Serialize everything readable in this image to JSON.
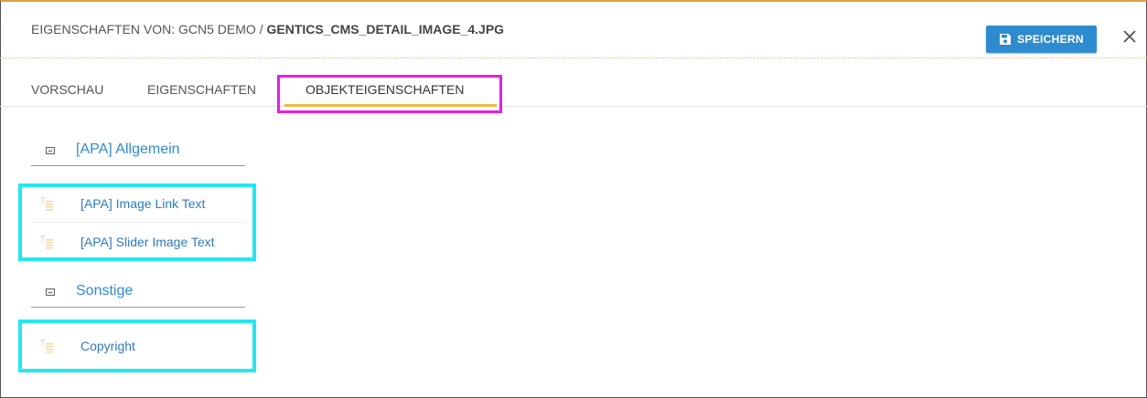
{
  "header": {
    "title_prefix": "EIGENSCHAFTEN VON: GCN5 DEMO / ",
    "title_file": "GENTICS_CMS_DETAIL_IMAGE_4.JPG",
    "save_label": "SPEICHERN",
    "save_icon": "floppy-disk-icon",
    "close_icon": "close-icon"
  },
  "tabs": [
    {
      "label": "VORSCHAU"
    },
    {
      "label": "EIGENSCHAFTEN"
    },
    {
      "label": "OBJEKTEIGENSCHAFTEN"
    }
  ],
  "active_tab": "OBJEKTEIGENSCHAFTEN",
  "groups": [
    {
      "label": "[APA] Allgemein",
      "items": [
        {
          "label": "[APA] Image Link Text",
          "icon": "text-property-icon"
        },
        {
          "label": "[APA] Slider Image Text",
          "icon": "text-property-icon"
        }
      ]
    },
    {
      "label": "Sonstige",
      "items": [
        {
          "label": "Copyright",
          "icon": "text-property-icon"
        }
      ]
    }
  ],
  "colors": {
    "accent": "#2f8bd0",
    "tab_underline": "#f0b840",
    "active_tab_highlight": "#e61ee6",
    "item_highlight": "#22e8f0"
  }
}
